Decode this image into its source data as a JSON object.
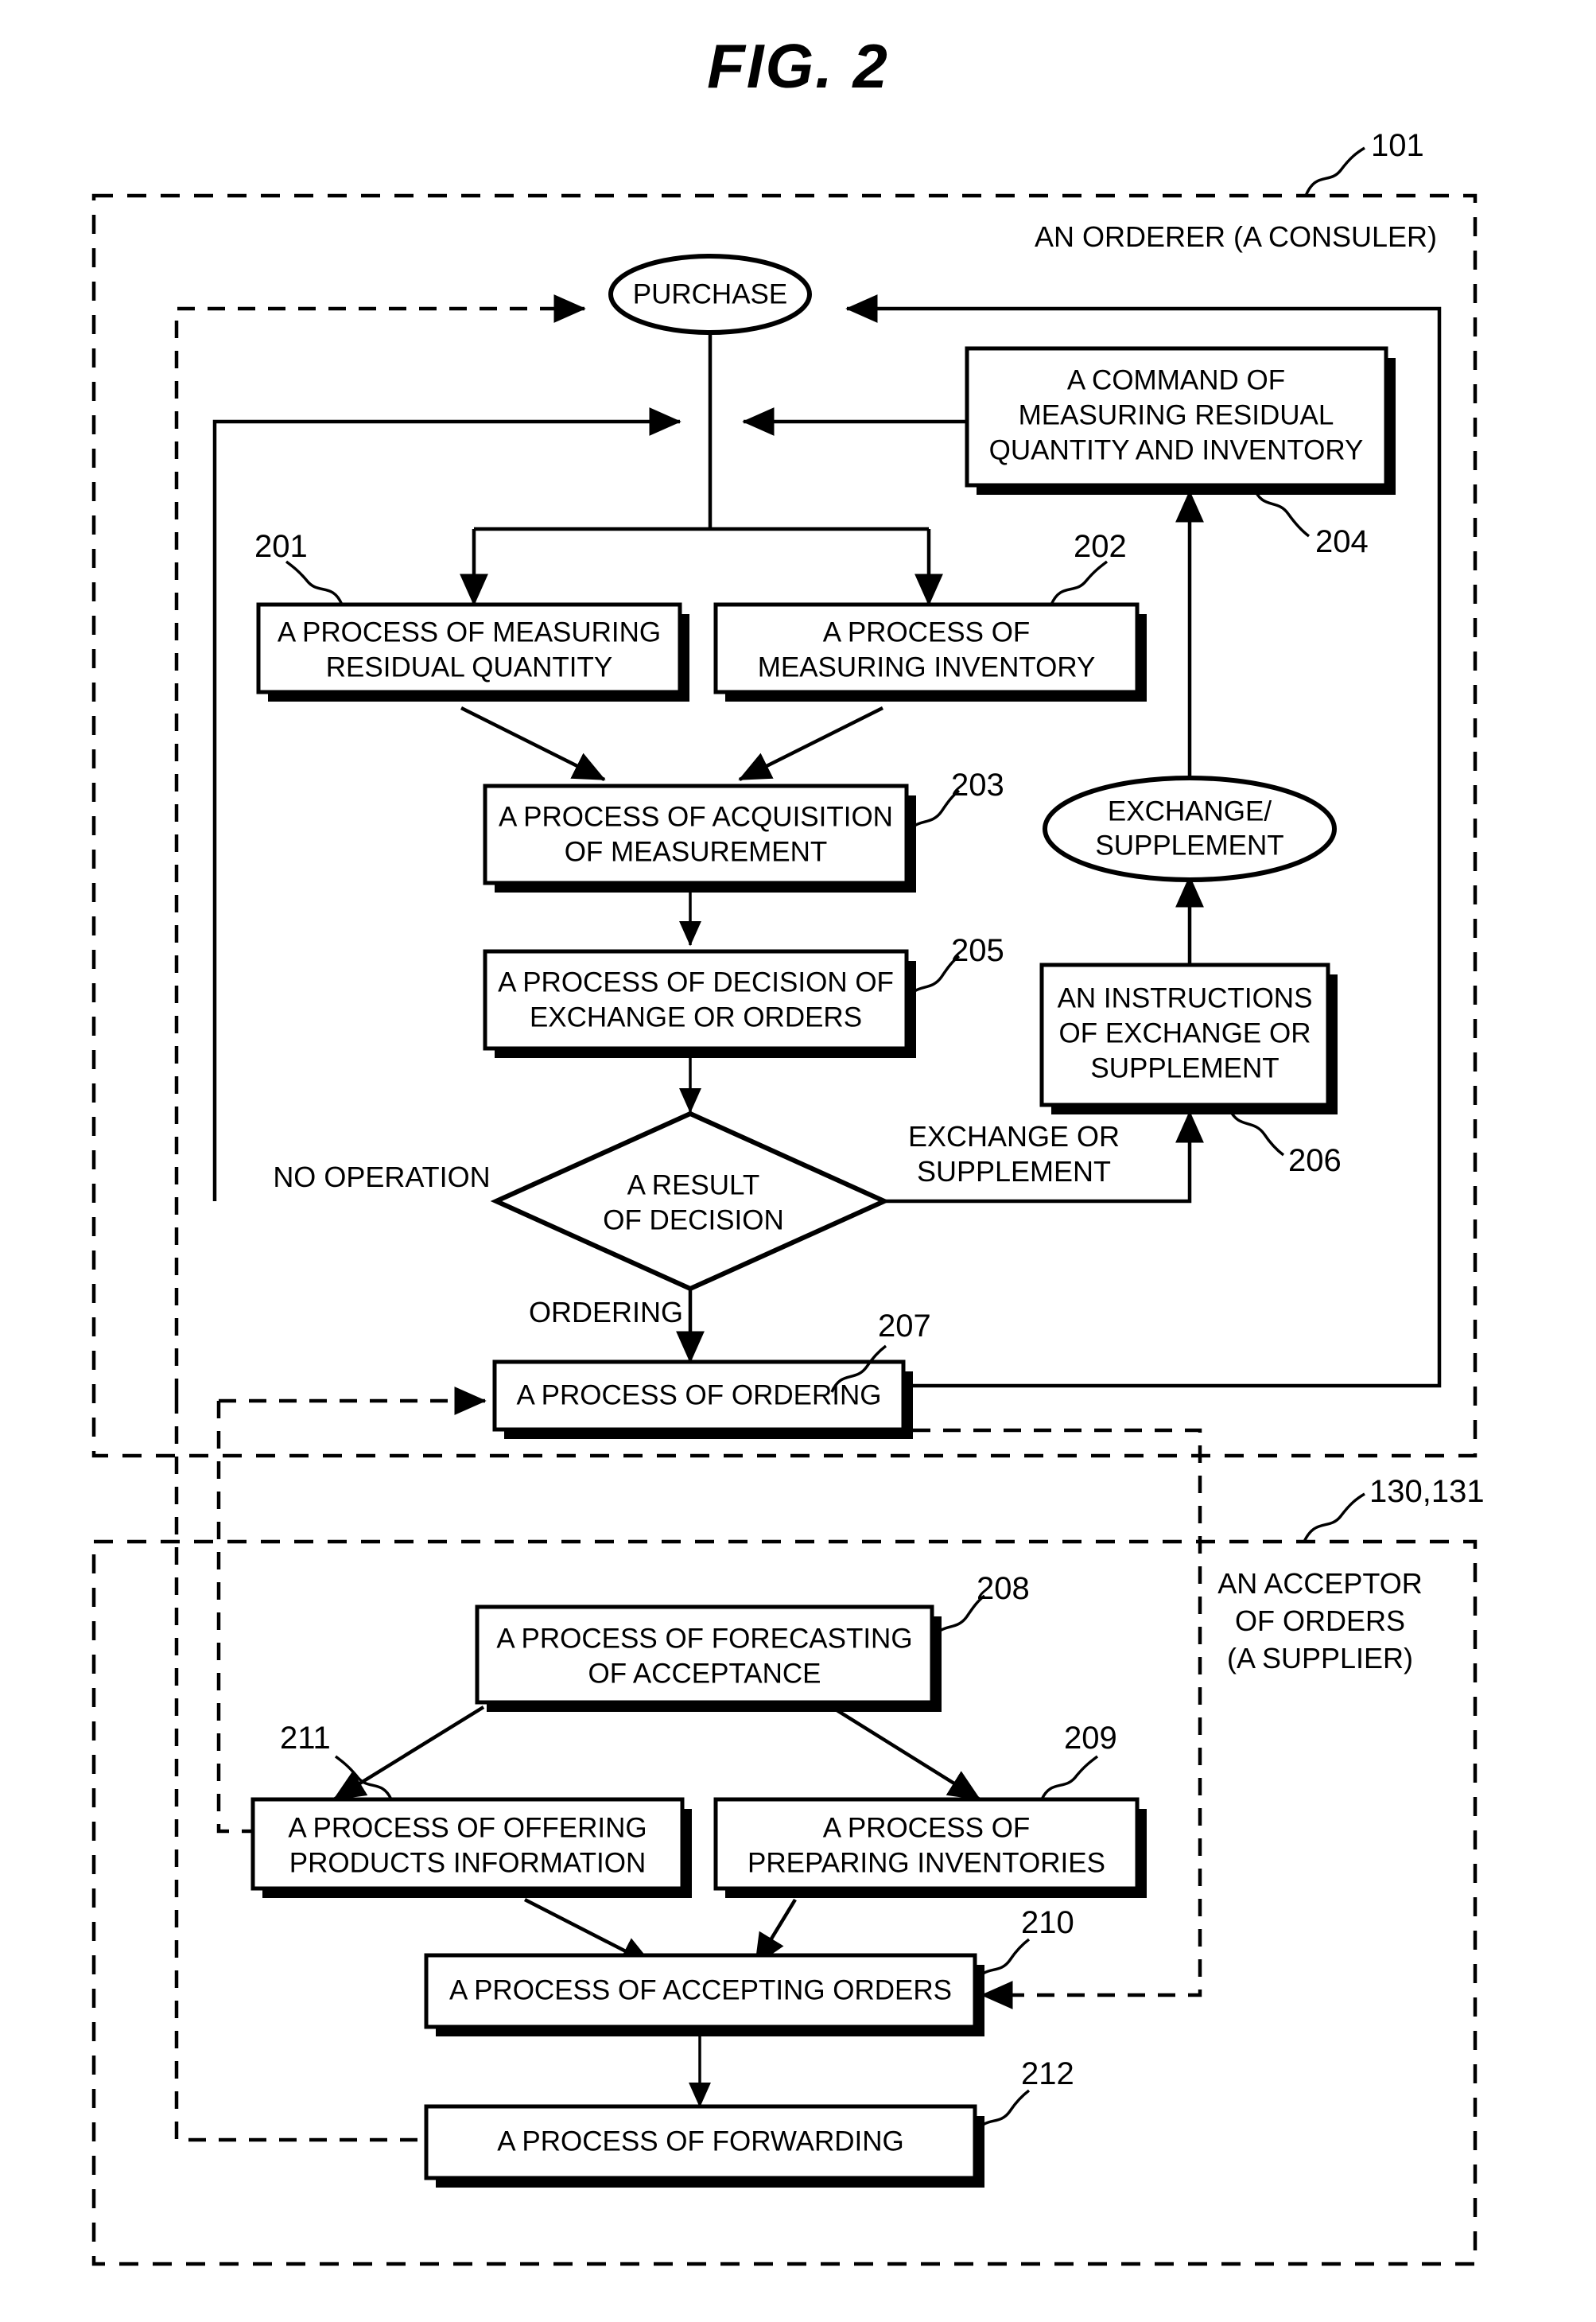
{
  "figure": {
    "title": "FIG. 2"
  },
  "zones": [
    {
      "id": "orderer",
      "ref": "101",
      "label_lines": [
        "AN ORDERER (A CONSULER)"
      ]
    },
    {
      "id": "acceptor",
      "ref": "130,131",
      "label_lines": [
        "AN ACCEPTOR",
        "OF ORDERS",
        "(A SUPPLIER)"
      ]
    }
  ],
  "nodes": {
    "purchase": {
      "ref": "",
      "lines": [
        "PURCHASE"
      ]
    },
    "command": {
      "ref": "204",
      "lines": [
        "A COMMAND OF",
        "MEASURING RESIDUAL",
        "QUANTITY AND INVENTORY"
      ]
    },
    "measure_residual": {
      "ref": "201",
      "lines": [
        "A PROCESS OF MEASURING",
        "RESIDUAL QUANTITY"
      ]
    },
    "measure_inventory": {
      "ref": "202",
      "lines": [
        "A PROCESS OF",
        "MEASURING INVENTORY"
      ]
    },
    "acquisition": {
      "ref": "203",
      "lines": [
        "A PROCESS OF ACQUISITION",
        "OF MEASUREMENT"
      ]
    },
    "decision_process": {
      "ref": "205",
      "lines": [
        "A PROCESS OF DECISION OF",
        "EXCHANGE OR ORDERS"
      ]
    },
    "exchange_supplement": {
      "ref": "",
      "lines": [
        "EXCHANGE/",
        "SUPPLEMENT"
      ]
    },
    "instructions": {
      "ref": "206",
      "lines": [
        "AN INSTRUCTIONS",
        "OF EXCHANGE OR",
        "SUPPLEMENT"
      ]
    },
    "result_decision": {
      "ref": "",
      "lines": [
        "A RESULT",
        "OF DECISION"
      ]
    },
    "ordering": {
      "ref": "207",
      "lines": [
        "A PROCESS OF ORDERING"
      ]
    },
    "forecasting": {
      "ref": "208",
      "lines": [
        "A PROCESS OF FORECASTING",
        "OF ACCEPTANCE"
      ]
    },
    "offering": {
      "ref": "211",
      "lines": [
        "A PROCESS OF OFFERING",
        "PRODUCTS INFORMATION"
      ]
    },
    "preparing": {
      "ref": "209",
      "lines": [
        "A PROCESS OF",
        "PREPARING INVENTORIES"
      ]
    },
    "accepting": {
      "ref": "210",
      "lines": [
        "A PROCESS OF ACCEPTING ORDERS"
      ]
    },
    "forwarding": {
      "ref": "212",
      "lines": [
        "A PROCESS OF FORWARDING"
      ]
    }
  },
  "edge_labels": {
    "no_operation": "NO OPERATION",
    "exchange_or": "EXCHANGE OR",
    "supplement": "SUPPLEMENT",
    "ordering": "ORDERING"
  },
  "colors": {
    "line": "#000000",
    "background": "#ffffff"
  }
}
